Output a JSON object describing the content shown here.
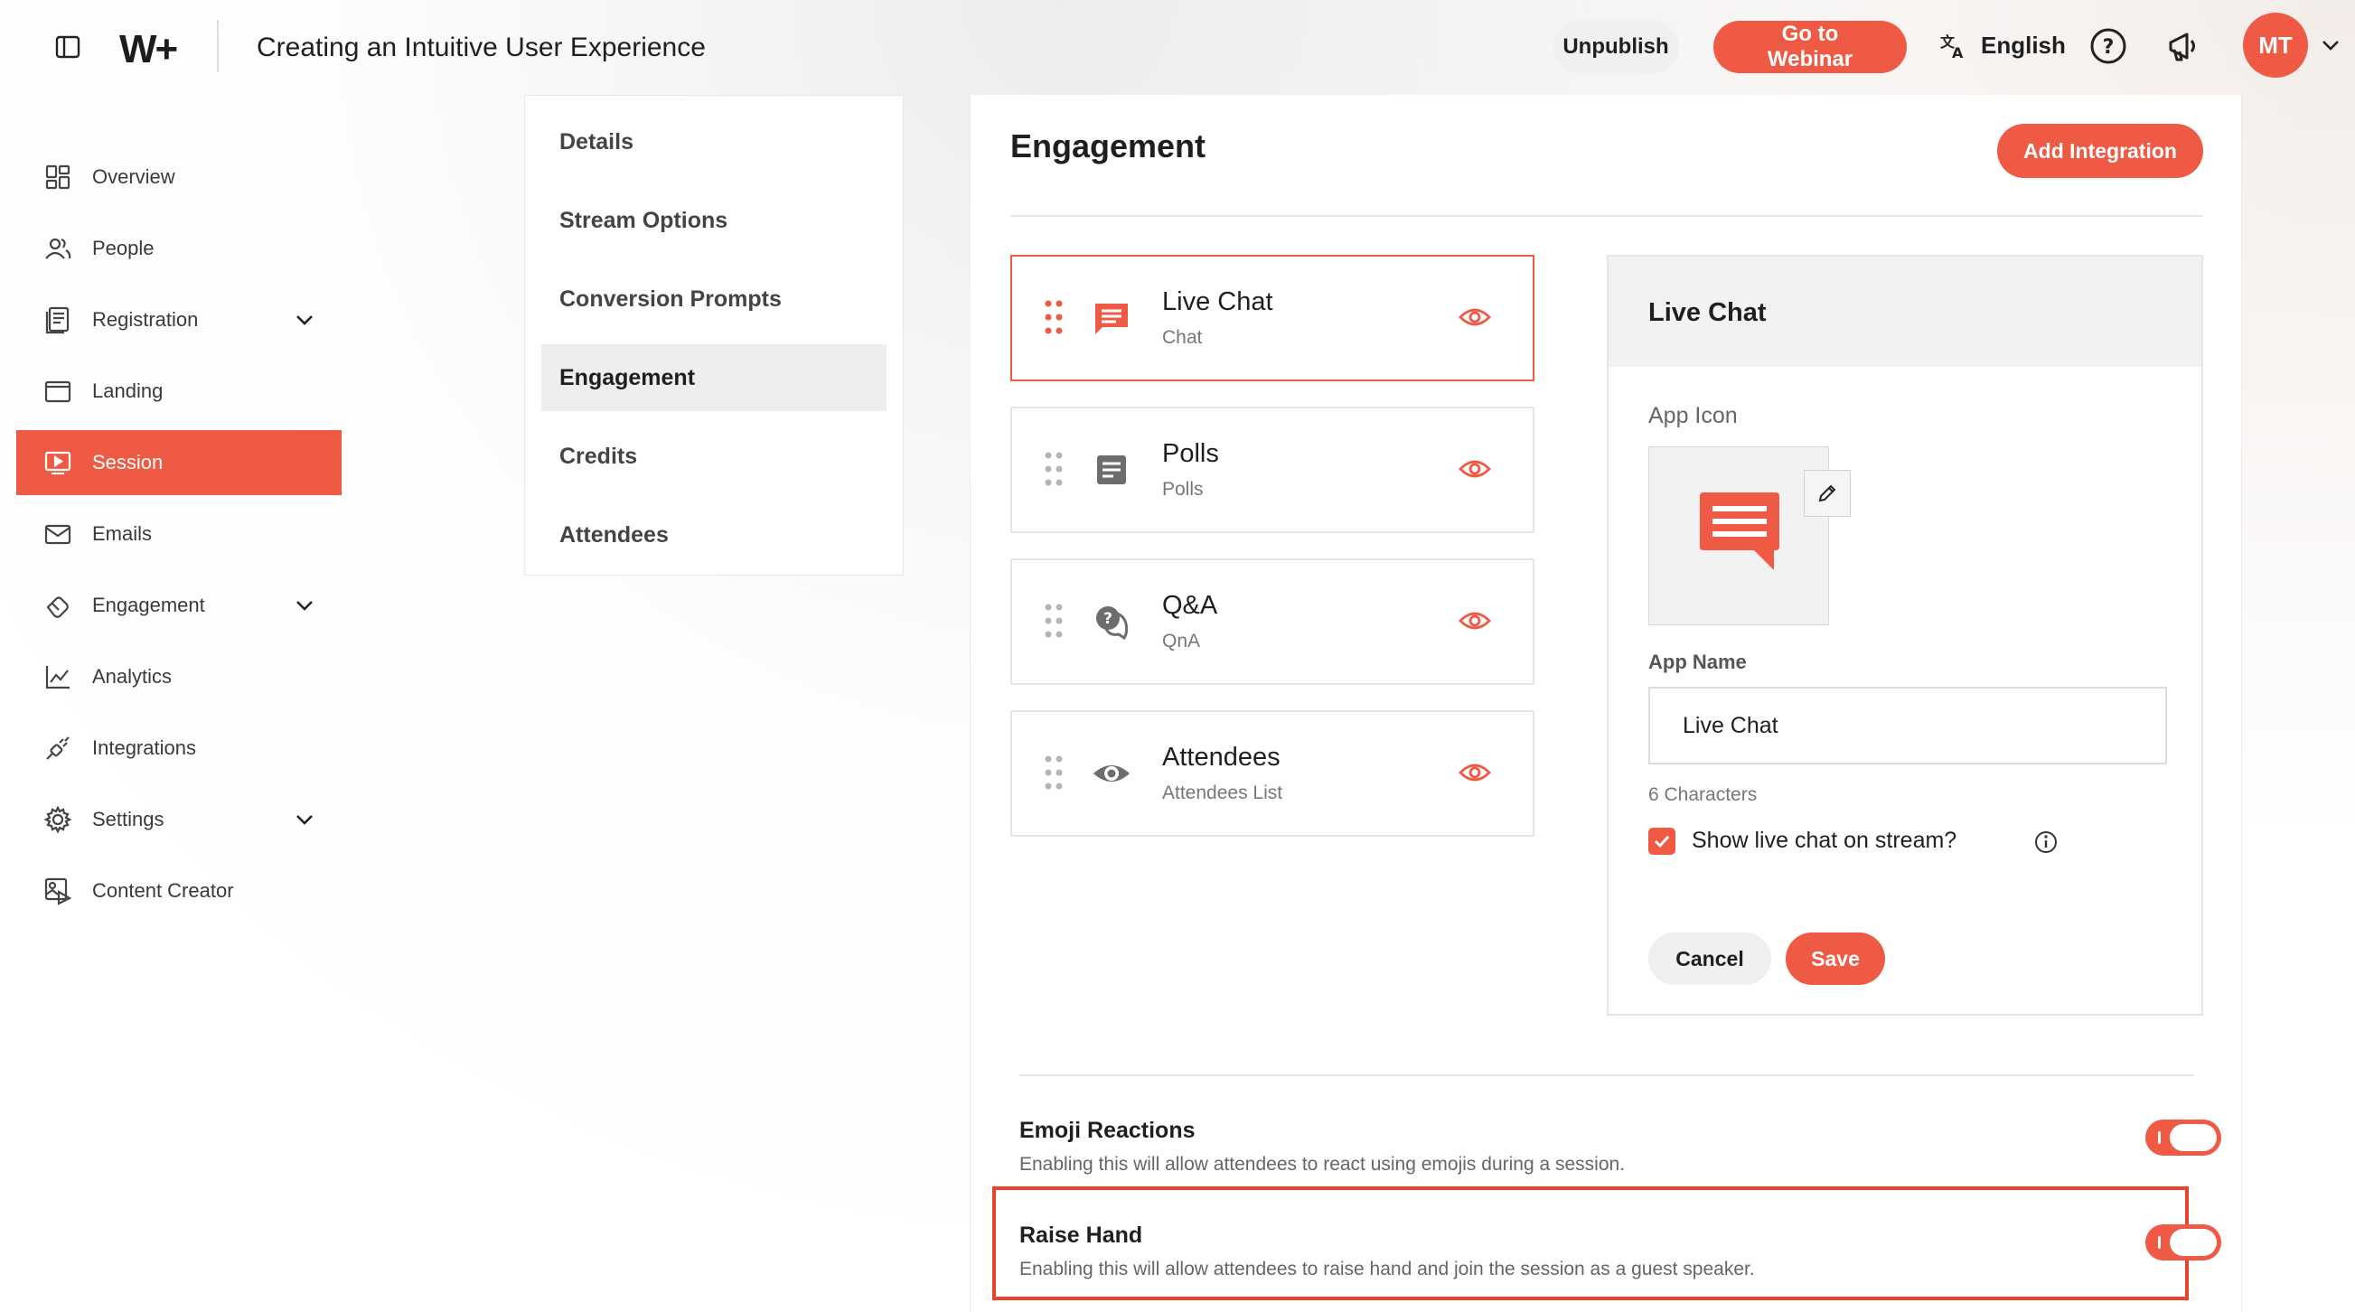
{
  "header": {
    "logo": "W+",
    "title": "Creating an Intuitive User Experience",
    "unpublish_label": "Unpublish",
    "go_webinar_label": "Go to Webinar",
    "language": "English",
    "avatar_initials": "MT"
  },
  "leftnav": {
    "items": [
      {
        "label": "Overview",
        "icon": "grid-icon"
      },
      {
        "label": "People",
        "icon": "people-icon"
      },
      {
        "label": "Registration",
        "icon": "form-icon",
        "expandable": true
      },
      {
        "label": "Landing",
        "icon": "browser-icon"
      },
      {
        "label": "Session",
        "icon": "play-screen-icon",
        "active": true
      },
      {
        "label": "Emails",
        "icon": "envelope-icon"
      },
      {
        "label": "Engagement",
        "icon": "hand-icon",
        "expandable": true
      },
      {
        "label": "Analytics",
        "icon": "line-chart-icon"
      },
      {
        "label": "Integrations",
        "icon": "plug-icon"
      },
      {
        "label": "Settings",
        "icon": "gear-icon",
        "expandable": true
      },
      {
        "label": "Content Creator",
        "icon": "media-icon"
      }
    ]
  },
  "submenu": {
    "items": [
      {
        "label": "Details"
      },
      {
        "label": "Stream Options"
      },
      {
        "label": "Conversion Prompts"
      },
      {
        "label": "Engagement",
        "active": true
      },
      {
        "label": "Credits"
      },
      {
        "label": "Attendees"
      }
    ]
  },
  "main": {
    "title": "Engagement",
    "add_integration_label": "Add Integration",
    "apps": [
      {
        "title": "Live Chat",
        "subtitle": "Chat",
        "selected": true
      },
      {
        "title": "Polls",
        "subtitle": "Polls"
      },
      {
        "title": "Q&A",
        "subtitle": "QnA"
      },
      {
        "title": "Attendees",
        "subtitle": "Attendees List"
      }
    ],
    "detail": {
      "title": "Live Chat",
      "app_icon_label": "App Icon",
      "app_name_label": "App Name",
      "app_name_value": "Live Chat",
      "char_count": "6 Characters",
      "show_on_stream_label": "Show live chat on stream?",
      "show_on_stream_checked": true,
      "cancel_label": "Cancel",
      "save_label": "Save"
    },
    "toggles": [
      {
        "title": "Emoji Reactions",
        "description": "Enabling this will allow attendees to react using emojis during a session.",
        "on": true
      },
      {
        "title": "Raise Hand",
        "description": "Enabling this will allow attendees to raise hand and join the session as a guest speaker.",
        "on": true
      }
    ]
  },
  "colors": {
    "accent": "#ee5a44",
    "highlight_border": "#e8432c"
  }
}
